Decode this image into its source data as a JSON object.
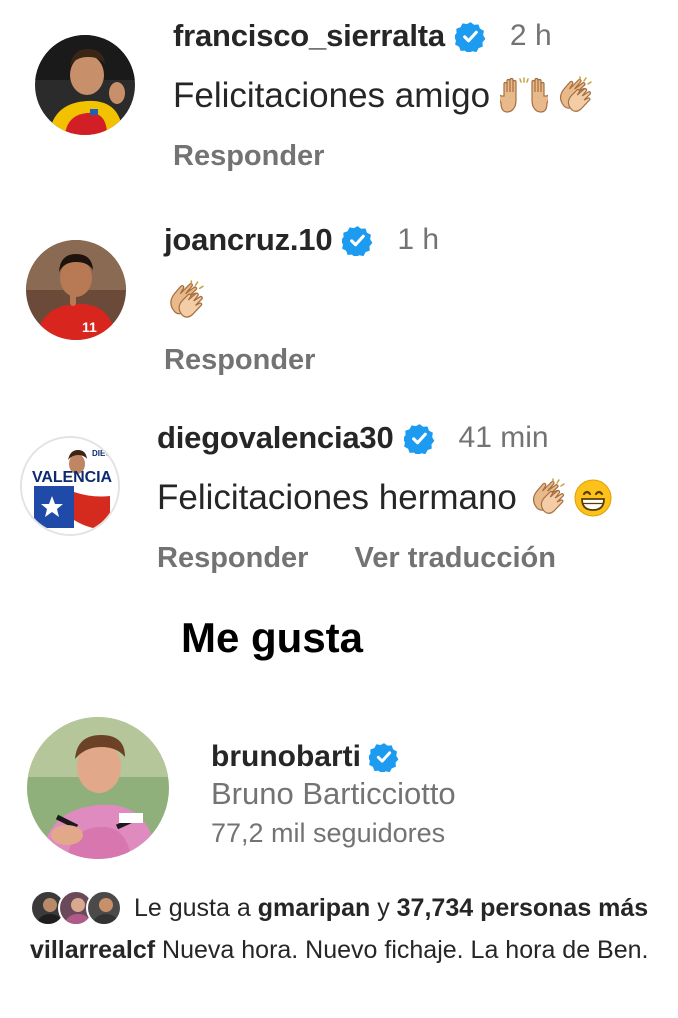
{
  "comments": [
    {
      "username": "francisco_sierralta",
      "time": "2 h",
      "text": "Felicitaciones amigo",
      "emojis": [
        "raising-hands-icon",
        "clapping-hands-icon"
      ],
      "actions": [
        "Responder"
      ]
    },
    {
      "username": "joancruz.10",
      "time": "1 h",
      "text": "",
      "emojis": [
        "clapping-hands-icon"
      ],
      "actions": [
        "Responder"
      ]
    },
    {
      "username": "diegovalencia30",
      "time": "41 min",
      "text": "Felicitaciones hermano",
      "emojis": [
        "clapping-hands-icon",
        "grinning-face-icon"
      ],
      "actions": [
        "Responder",
        "Ver traducción"
      ],
      "avatar_text": [
        "DIEGO",
        "VALENCIA"
      ]
    }
  ],
  "likes_section": {
    "title": "Me gusta",
    "user": {
      "username": "brunobarti",
      "full_name": "Bruno Barticciotto",
      "followers": "77,2 mil seguidores"
    }
  },
  "likes_summary": {
    "prefix": "Le gusta a",
    "user": "gmaripan",
    "connector": "y",
    "others": "37,734 personas más"
  },
  "caption": {
    "username": "villarrealcf",
    "text": "Nueva hora. Nuevo fichaje. La hora de Ben."
  },
  "colors": {
    "verified": "#1d9bf0",
    "text_primary": "#262626",
    "text_secondary": "#737373"
  }
}
